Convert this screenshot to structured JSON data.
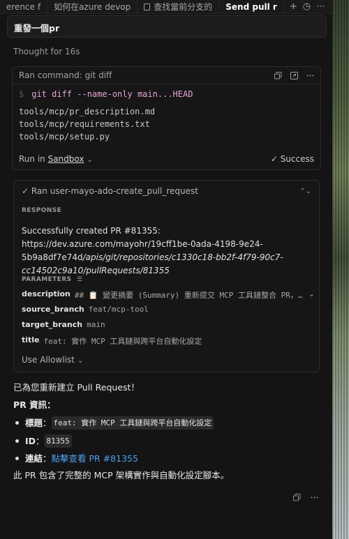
{
  "tabs": [
    {
      "label": "erence f",
      "active": false,
      "icon": null
    },
    {
      "label": "如何在azure devop",
      "active": false,
      "icon": null
    },
    {
      "label": "查找當前分支的",
      "active": false,
      "icon": "document-icon"
    },
    {
      "label": "Send pull r",
      "active": true,
      "icon": null
    }
  ],
  "tab_actions": {
    "add": "+",
    "history": "◷",
    "more": "⋯"
  },
  "prompt": {
    "text": "重發一個pr"
  },
  "thought": {
    "text": "Thought for 16s"
  },
  "command_card": {
    "title": "Ran command: git diff",
    "prompt_sign": "$",
    "command": "git diff --name-only main...HEAD",
    "output": [
      "tools/mcp/pr_description.md",
      "tools/mcp/requirements.txt",
      "tools/mcp/setup.py"
    ],
    "run_in_prefix": "Run in ",
    "run_in_target": "Sandbox",
    "status": "Success"
  },
  "tool_card": {
    "title": "Ran user-mayo-ado-create_pull_request",
    "response_label": "RESPONSE",
    "response_prefix": "Successfully created PR #81355: https://dev.azure.com/mayohr/19cff1be-0ada-4198-9e24-5b9a8df7e74d",
    "response_path": "/apis/git/repositories/c1330c18-bb2f-4f79-90c7-cc14502c9a10/pullRequests/81355",
    "parameters_label": "PARAMETERS",
    "params": [
      {
        "key": "description",
        "value": "## 📋 變更摘要 (Summary) 重新提交 MCP 工具鏈整合 PR，..."
      },
      {
        "key": "source_branch",
        "value": "feat/mcp-tool"
      },
      {
        "key": "target_branch",
        "value": "main"
      },
      {
        "key": "title",
        "value": "feat: 實作 MCP 工具鏈與跨平台自動化設定"
      }
    ],
    "allowlist": "Use Allowlist"
  },
  "answer": {
    "line1": "已為您重新建立 Pull Request！",
    "heading": "PR 資訊：",
    "items": [
      {
        "label": "標題",
        "sep": "：",
        "code": "feat: 實作 MCP 工具鏈與跨平台自動化設定",
        "link": null
      },
      {
        "label": "ID",
        "sep": "：",
        "code": "81355",
        "link": null
      },
      {
        "label": "連結",
        "sep": "：",
        "code": null,
        "link": "點擊查看 PR #81355"
      }
    ],
    "closing": "此 PR 包含了完整的 MCP 架構實作與自動化設定腳本。"
  },
  "colors": {
    "background": "#141414",
    "command_text": "#e6a5d6",
    "link": "#4aa3f0"
  }
}
